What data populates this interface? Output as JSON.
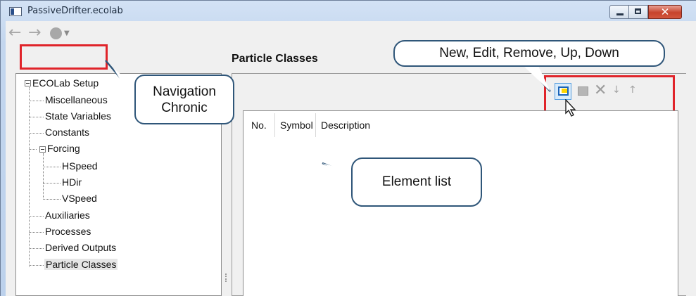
{
  "window": {
    "title": "PassiveDrifter.ecolab",
    "caption_buttons": [
      "minimize",
      "maximize",
      "close"
    ]
  },
  "navigation": {
    "icons": [
      "back-arrow-icon",
      "forward-arrow-icon",
      "history-dot-icon",
      "dropdown-caret-icon"
    ]
  },
  "page": {
    "title": "Particle Classes"
  },
  "tree": {
    "root": "ECOLab Setup",
    "items": [
      "Miscellaneous",
      "State Variables",
      "Constants"
    ],
    "forcing": {
      "label": "Forcing",
      "children": [
        "HSpeed",
        "HDir",
        "VSpeed"
      ]
    },
    "items2": [
      "Auxiliaries",
      "Processes",
      "Derived Outputs",
      "Particle Classes"
    ],
    "selected": "Particle Classes"
  },
  "toolbar": {
    "buttons": [
      "new-icon",
      "edit-icon",
      "remove-icon",
      "down-icon",
      "up-icon"
    ]
  },
  "list": {
    "columns": [
      "No.",
      "Symbol",
      "Description"
    ],
    "rows": []
  },
  "annotations": {
    "navigation": [
      "Navigation",
      "Chronic"
    ],
    "toolbar": "New, Edit, Remove, Up, Down",
    "list": "Element list",
    "highlight_color": "#e0242a",
    "callout_border_color": "#2f5679"
  }
}
